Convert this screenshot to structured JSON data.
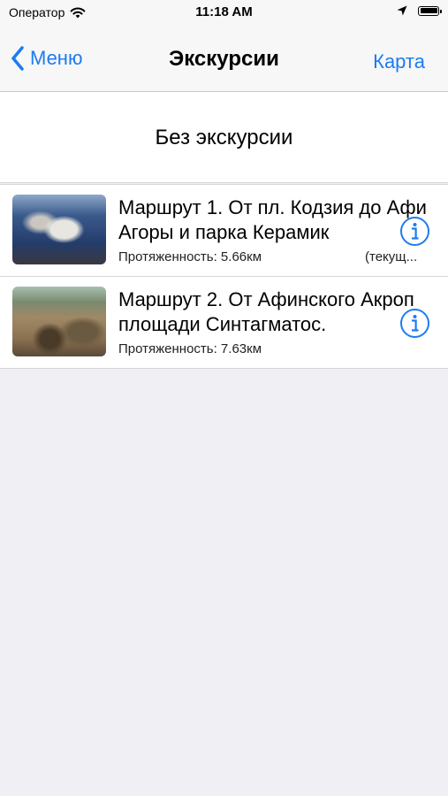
{
  "status_bar": {
    "carrier": "Оператор",
    "time": "11:18 AM"
  },
  "nav": {
    "back_label": "Меню",
    "title": "Экскурсии",
    "right_label": "Карта"
  },
  "no_excursion_label": "Без экскурсии",
  "routes": [
    {
      "title_line1": "Маршрут 1. От пл. Кодзия до Афи",
      "title_line2": "Агоры и парка Керамик",
      "length": "Протяженность: 5.66км",
      "current": "(текущ..."
    },
    {
      "title_line1": "Маршрут 2. От Афинского Акроп",
      "title_line2": "площади Синтагматос.",
      "length": "Протяженность: 7.63км"
    }
  ],
  "colors": {
    "accent": "#1c7cf0",
    "background": "#efeff4"
  }
}
